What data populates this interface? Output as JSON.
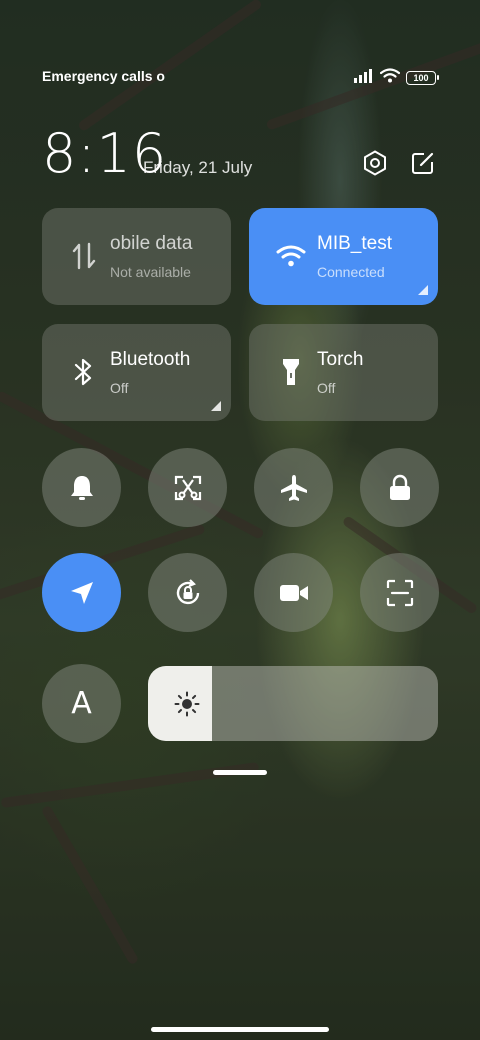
{
  "status_bar": {
    "carrier_text": "Emergency calls o",
    "battery_level": "100",
    "icons": [
      "signal-icon",
      "wifi-icon",
      "battery-icon"
    ]
  },
  "header": {
    "time": "8:16",
    "date": "Friday, 21 July",
    "actions": [
      "settings-icon",
      "edit-icon"
    ]
  },
  "tiles": {
    "mobile_data": {
      "title": "obile data",
      "subtitle": "Not available",
      "active": false,
      "icon": "mobile-data-icon"
    },
    "wifi": {
      "title": "MIB_test",
      "subtitle": "Connected",
      "active": true,
      "icon": "wifi-icon"
    },
    "bluetooth": {
      "title": "Bluetooth",
      "subtitle": "Off",
      "active": false,
      "icon": "bluetooth-icon"
    },
    "torch": {
      "title": "Torch",
      "subtitle": "Off",
      "active": false,
      "icon": "torch-icon"
    }
  },
  "toggles": {
    "row1": [
      "bell-icon",
      "screenshot-icon",
      "airplane-icon",
      "lock-icon"
    ],
    "row2": [
      "location-icon",
      "rotation-lock-icon",
      "video-camera-icon",
      "scanner-icon"
    ],
    "auto_brightness_label": "A",
    "location_active": true
  },
  "brightness": {
    "level_fraction": 0.22,
    "icon": "sun-icon"
  },
  "colors": {
    "accent": "#4a8ff5",
    "tile_bg": "rgba(120,125,115,0.45)"
  }
}
